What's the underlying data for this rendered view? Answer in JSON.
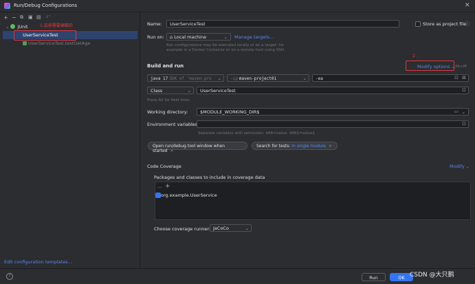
{
  "window": {
    "title": "Run/Debug Configurations",
    "close_glyph": "✕"
  },
  "toolbar": {
    "add": "+",
    "remove": "−",
    "copy": "⧉",
    "save": "▣",
    "folder": "▤",
    "sort": "↓ᵃ"
  },
  "tree": {
    "group_label": "JUnit",
    "group_chevron": "⌄",
    "items": [
      {
        "label": "UserServiceTest",
        "selected": true
      },
      {
        "label": "UserServiceTest.testGetAge",
        "selected": false
      }
    ],
    "annotation_1": "1.选择需要编辑的"
  },
  "left_footer": {
    "edit_templates": "Edit configuration templates..."
  },
  "form": {
    "name_label": "Name:",
    "name_value": "UserServiceTest",
    "store_as_project_file": "Store as project file",
    "run_on_label": "Run on:",
    "run_on_value": "Local machine",
    "run_on_icon": "⌂",
    "manage_targets": "Manage targets...",
    "run_on_hint": "Run configurations may be executed locally or on a target: for example in a Docker Container or on a remote host using SSH.",
    "build_and_run": "Build and run",
    "modify_options": "Modify options",
    "modify_shortcut": "Alt+M",
    "annotation_2": "2.",
    "jdk_value": "java 17",
    "jdk_suffix": "SDK of 'maven-pro",
    "cp_prefix": "-cp",
    "cp_value": "maven-project01",
    "vm_value": "-ea",
    "class_kind": "Class",
    "class_value": "UserServiceTest",
    "field_hint": "Press Alt for field hints",
    "working_dir_label": "Working directory:",
    "working_dir_value": "$MODULE_WORKING_DIR$",
    "env_label": "Environment variables:",
    "env_hint": "Separate variables with semicolon: VAR=value; VAR1=value1",
    "chip_1": "Open run/debug tool window when started",
    "chip_2_prefix": "Search for tests:",
    "chip_2_value": "In single module",
    "chip_close": "×"
  },
  "coverage": {
    "title": "Code Coverage",
    "modify": "Modify",
    "packages_label": "Packages and classes to include in coverage data",
    "remove_glyph": "—",
    "add_glyph": "+",
    "entry": "org.example.UserService",
    "runner_label": "Choose coverage runner:",
    "runner_value": "JaCoCo"
  },
  "buttons": {
    "run": "Run",
    "ok": "OK",
    "help": "?"
  },
  "watermark": "CSDN @大只鹅",
  "colors": {
    "accent": "#3574f0",
    "link": "#548af7",
    "annotation": "#e0393e",
    "background": "#2b2d30",
    "selection": "#2e436e"
  }
}
